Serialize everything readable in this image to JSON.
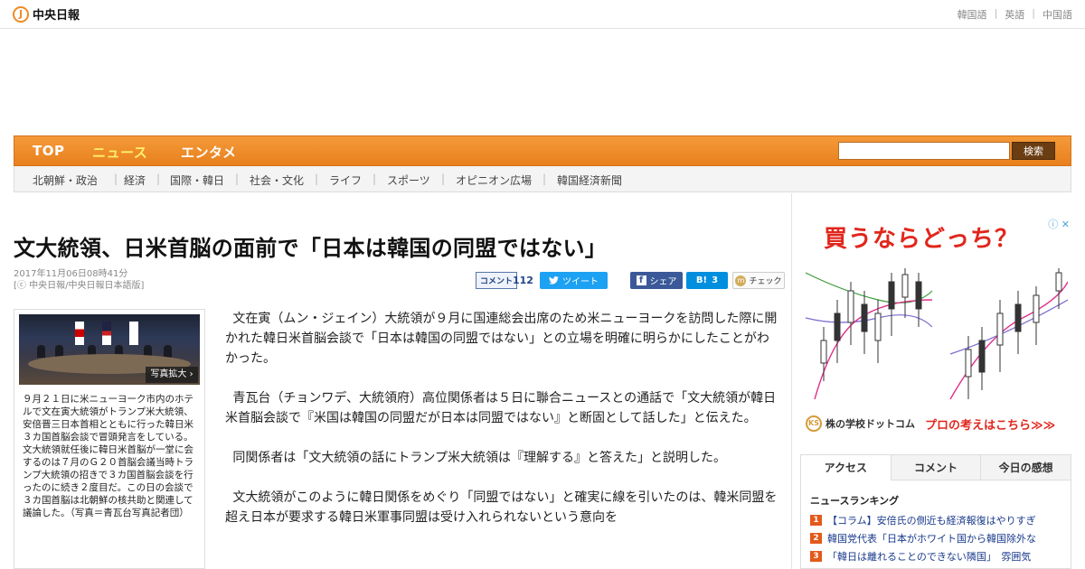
{
  "header": {
    "logo_mark": "J",
    "logo_text": "中央日報",
    "languages": [
      "韓国語",
      "英語",
      "中国語"
    ]
  },
  "nav": {
    "items": [
      "TOP",
      "ニュース",
      "エンタメ"
    ],
    "search_button": "検索",
    "search_value": ""
  },
  "subnav": {
    "items": [
      "北朝鮮・政治",
      "経済",
      "国際・韓日",
      "社会・文化",
      "ライフ",
      "スポーツ",
      "オピニオン広場",
      "韓国経済新聞"
    ]
  },
  "article": {
    "title": "文大統領、日米首脳の面前で「日本は韓国の同盟ではない」",
    "date": "2017年11月06日08時41分",
    "source": "[ⓒ 中央日報/中央日報日本語版]",
    "comment_label": "コメント",
    "comment_count": "112",
    "tweet_label": "ツイート",
    "share_label": "シェア",
    "hatena_label": "B!",
    "hatena_count": "3",
    "check_label": "チェック",
    "photo_enlarge": "写真拡大",
    "caption": "９月２１日に米ニューヨーク市内のホテルで文在寅大統領がトランプ米大統領、安倍晋三日本首相とともに行った韓日米３カ国首脳会談で冒頭発言をしている。文大統領就任後に韓日米首脳が一堂に会するのは７月のＧ２０首脳会議当時トランプ大統領の招きで３カ国首脳会談を行ったのに続き２度目だ。この日の会談で３カ国首脳は北朝鮮の核共助と関連して議論した。（写真＝青瓦台写真記者団）",
    "paragraphs": [
      "文在寅（ムン・ジェイン）大統領が９月に国連総会出席のため米ニューヨークを訪問した際に開かれた韓日米首脳会談で「日本は韓国の同盟ではない」との立場を明確に明らかにしたことがわかった。",
      "青瓦台（チョンワデ、大統領府）高位関係者は５日に聯合ニュースとの通話で「文大統領が韓日米首脳会談で『米国は韓国の同盟だが日本は同盟ではない』と断固として話した」と伝えた。",
      "同関係者は「文大統領の話にトランプ米大統領は『理解する』と答えた」と説明した。",
      "文大統領がこのように韓日関係をめぐり「同盟ではない」と確実に線を引いたのは、韓米同盟を超え日本が要求する韓日米軍事同盟は受け入れられないという意向を"
    ]
  },
  "ad": {
    "title": "買うならどっち？",
    "info_icon": "info-icon",
    "school_mark": "KS",
    "school_name": "株の学校ドットコム",
    "cta": "プロの考えはこちら≫≫"
  },
  "ranking": {
    "tabs": [
      "アクセス",
      "コメント",
      "今日の感想"
    ],
    "title": "ニュースランキング",
    "items": [
      {
        "num": "1",
        "text": "【コラム】安倍氏の側近も経済報復はやりすぎ"
      },
      {
        "num": "2",
        "text": "韓国党代表「日本がホワイト国から韓国除外な"
      },
      {
        "num": "3",
        "text": "「韓日は離れることのできない隣国」　雰囲気"
      }
    ]
  },
  "colors": {
    "nav_orange": "#e8801d",
    "active_nav": "#fdf06a",
    "ad_red": "#e1261c",
    "twitter": "#1da1f2",
    "facebook": "#3b5998",
    "hatena": "#008fde",
    "rank_badge": "#e35a1b"
  }
}
